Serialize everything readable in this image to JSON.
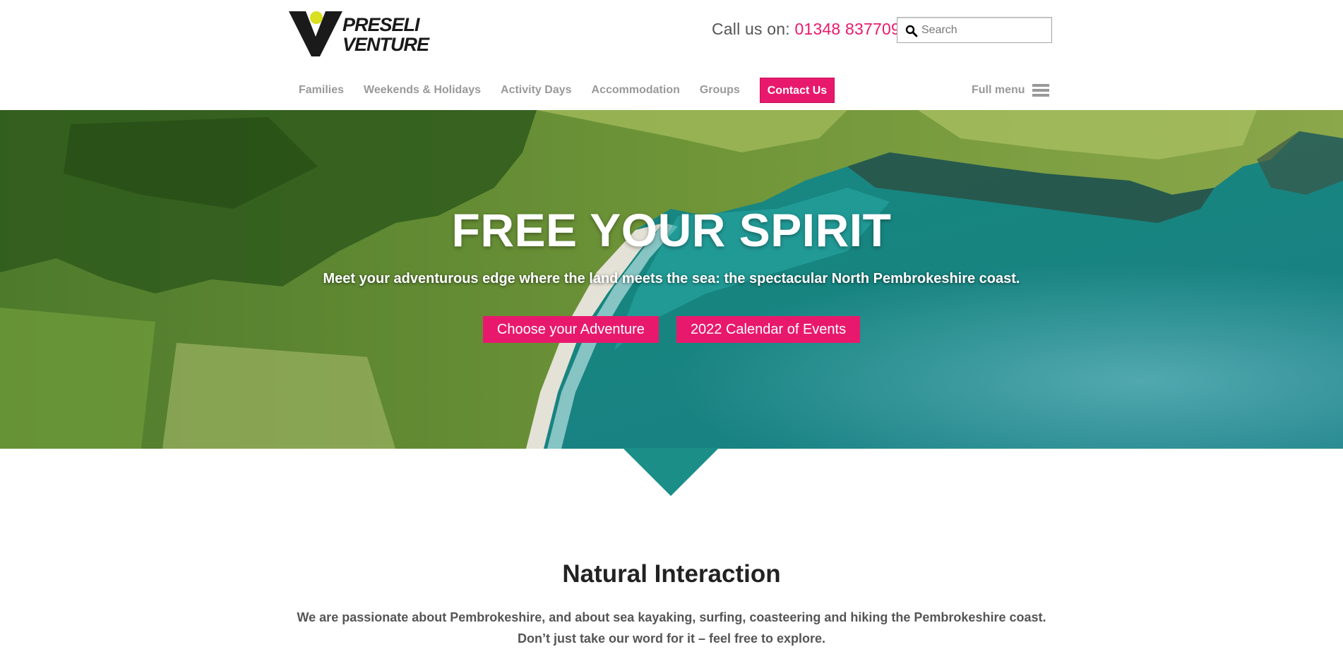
{
  "brand": {
    "logo_line1": "PRESELI",
    "logo_line2": "VENTURE",
    "accent_color": "#e8196d",
    "logo_dot_color": "#d9e021"
  },
  "header": {
    "call_label": "Call us on:",
    "phone": "01348 837709",
    "search": {
      "placeholder": "Search",
      "icon": "search-icon"
    }
  },
  "nav": {
    "items": [
      {
        "label": "Families"
      },
      {
        "label": "Weekends & Holidays"
      },
      {
        "label": "Activity Days"
      },
      {
        "label": "Accommodation"
      },
      {
        "label": "Groups"
      }
    ],
    "contact_label": "Contact Us",
    "full_menu_label": "Full menu",
    "full_menu_icon": "hamburger-icon"
  },
  "hero": {
    "title": "FREE YOUR SPIRIT",
    "subtitle": "Meet your adventurous edge where the land meets the sea: the spectacular North Pembrokeshire coast.",
    "buttons": [
      {
        "label": "Choose your Adventure"
      },
      {
        "label": "2022 Calendar of Events"
      }
    ],
    "pointer_color": "#1b8e88"
  },
  "intro": {
    "title": "Natural Interaction",
    "line1": "We are passionate about Pembrokeshire, and about sea kayaking, surfing, coasteering and hiking the Pembrokeshire coast.",
    "line2": "Don’t just take our word for it – feel free to explore."
  }
}
